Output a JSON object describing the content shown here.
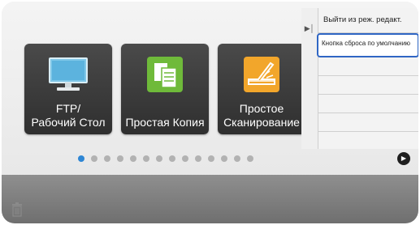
{
  "tiles": [
    {
      "icon": "monitor-icon",
      "label_line1": "FTP/",
      "label_line2": "Рабочий Стол"
    },
    {
      "icon": "copy-document-icon",
      "label_line1": "Простая Копия",
      "label_line2": ""
    },
    {
      "icon": "scanner-icon",
      "label_line1": "Простое",
      "label_line2": "Сканирование"
    }
  ],
  "panel": {
    "items": [
      "Выйти из реж. редакт.",
      "Кнопка сброса по умолчанию"
    ],
    "toggle_icon": "expand-left-icon"
  },
  "pagination": {
    "count": 14,
    "active_index": 0,
    "next_icon": "next-page-icon"
  },
  "colors": {
    "accent": "#2e86d4",
    "selected_border": "#2f66c4"
  },
  "bottom": {
    "trash_icon": "trash-icon"
  }
}
